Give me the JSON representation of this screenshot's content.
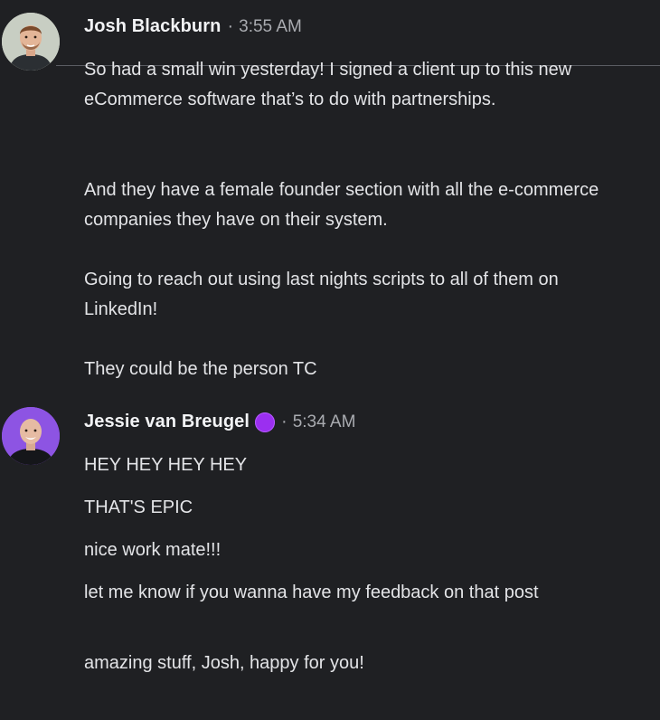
{
  "messages": [
    {
      "author": "Josh Blackburn",
      "separator": "·",
      "time": "3:55 AM",
      "paragraphs": [
        "So had a small win yesterday! I signed a client up to this new eCommerce software that’s to do with partnerships.",
        "And they have a female founder section with all the e-commerce companies they have on their system.",
        "Going to reach out using last nights scripts to all of them on LinkedIn!",
        "They could be the person TC"
      ]
    },
    {
      "author": "Jessie van Breugel",
      "badge_icon": "purple-circle-badge",
      "badge_color": "#9b2ff0",
      "separator": "·",
      "time": "5:34 AM",
      "paragraphs": [
        "HEY HEY HEY HEY",
        "THAT'S EPIC",
        "nice work mate!!!",
        "let me know if you wanna have my feedback on that post",
        "amazing stuff, Josh, happy for you!"
      ]
    }
  ],
  "colors": {
    "background": "#1f2023",
    "text": "#e3e4e7",
    "muted": "#a9abb0",
    "avatar_purple": "#8d54e3"
  }
}
